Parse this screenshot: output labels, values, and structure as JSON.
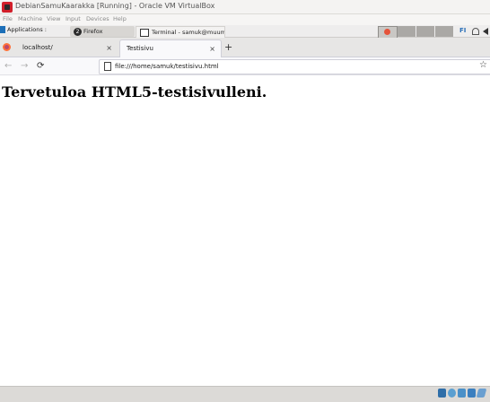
{
  "window": {
    "title": "DebianSamuKaarakka [Running] - Oracle VM VirtualBox"
  },
  "vbox_menu": {
    "items": [
      "File",
      "Machine",
      "View",
      "Input",
      "Devices",
      "Help"
    ]
  },
  "guest_panel": {
    "applications_label": "Applications :",
    "tasks": [
      {
        "label": "Firefox",
        "badge": "2"
      },
      {
        "label": "Terminal - samuk@muumi..."
      }
    ],
    "keyboard_layout": "FI"
  },
  "browser": {
    "tabs": [
      {
        "label": "localhost/",
        "close": "×"
      },
      {
        "label": "Testisivu",
        "close": "×"
      }
    ],
    "new_tab": "+",
    "nav": {
      "back": "←",
      "forward": "→",
      "reload": "⟳"
    },
    "url": "file:///home/samuk/testisivu.html",
    "bookmark": "☆"
  },
  "page": {
    "heading": "Tervetuloa HTML5-testisivulleni."
  }
}
